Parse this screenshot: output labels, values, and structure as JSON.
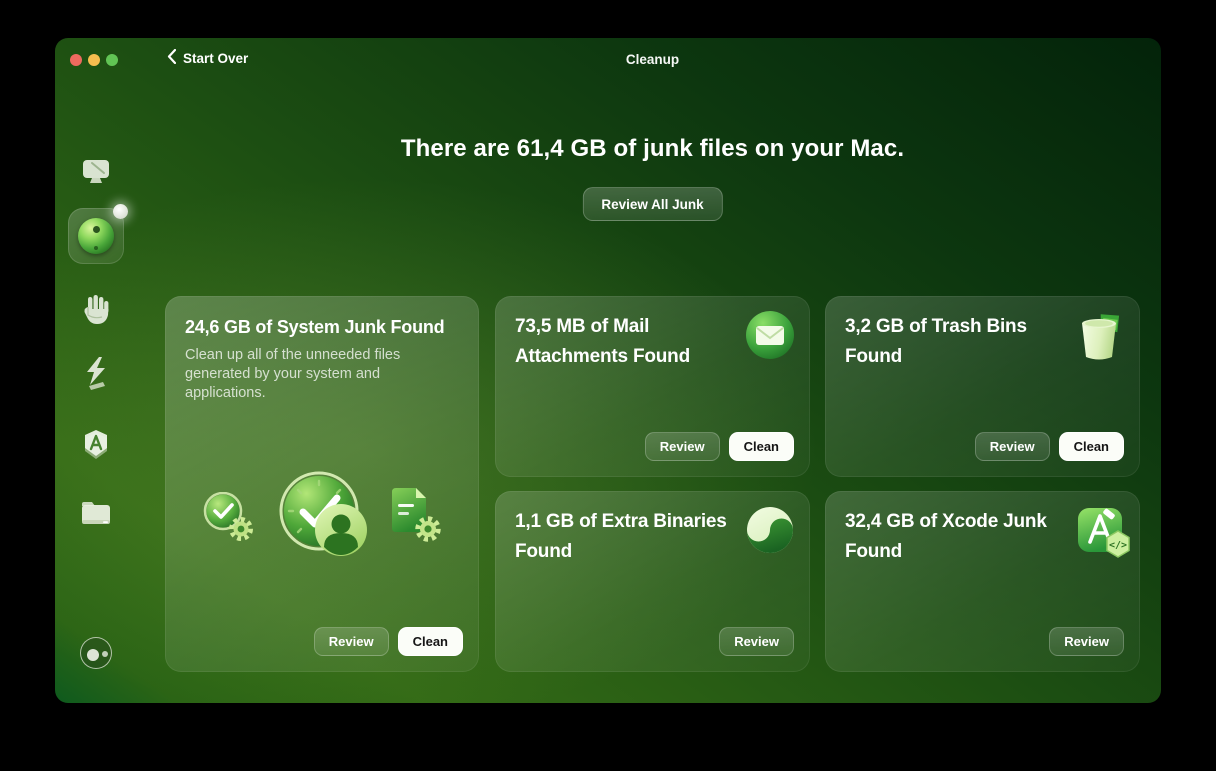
{
  "titlebar": {
    "back_label": "Start Over",
    "window_title": "Cleanup"
  },
  "summary": {
    "headline": "There are 61,4 GB of junk files on your Mac.",
    "review_all_label": "Review All Junk"
  },
  "sidebar": {
    "items": [
      {
        "icon": "mac-display-icon"
      },
      {
        "icon": "cleanup-sphere-icon",
        "selected": true,
        "has_notification_dot": true
      },
      {
        "icon": "hand-icon"
      },
      {
        "icon": "lightning-icon"
      },
      {
        "icon": "applications-icon"
      },
      {
        "icon": "folder-icon"
      },
      {
        "icon": "assistant-avatar-icon"
      }
    ]
  },
  "cards": {
    "system_junk": {
      "title": "24,6 GB of System Junk Found",
      "description": "Clean up all of the unneeded files generated by your system and applications.",
      "icons": [
        "clock-gear-icon",
        "clock-user-icon",
        "document-gear-icon"
      ],
      "review_label": "Review",
      "clean_label": "Clean"
    },
    "mail_attachments": {
      "title": "73,5 MB of Mail Attachments Found",
      "icon": "mail-envelope-icon",
      "review_label": "Review",
      "clean_label": "Clean"
    },
    "trash_bins": {
      "title": "3,2 GB of Trash Bins Found",
      "icon": "trash-bin-icon",
      "review_label": "Review",
      "clean_label": "Clean"
    },
    "extra_binaries": {
      "title": "1,1 GB of Extra Binaries Found",
      "icon": "binaries-yin-yang-icon",
      "review_label": "Review"
    },
    "xcode_junk": {
      "title": "32,4 GB of Xcode Junk Found",
      "icon": "xcode-icon",
      "review_label": "Review"
    }
  },
  "colors": {
    "traffic_red": "#ee6a5f",
    "traffic_yellow": "#f5bd4f",
    "traffic_green": "#61c454",
    "accent_green_dark": "#0e5a1e",
    "accent_green_light": "#8fd95e",
    "clean_button_bg": "#fbfdf8"
  }
}
